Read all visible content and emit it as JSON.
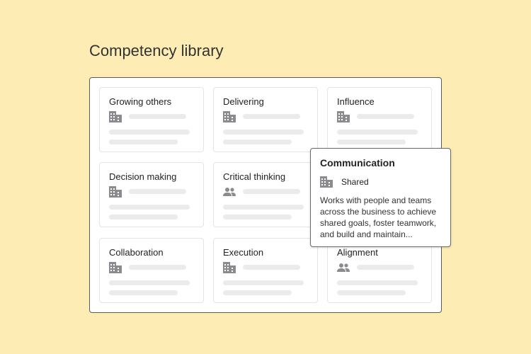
{
  "page": {
    "title": "Competency library"
  },
  "cards": [
    {
      "title": "Growing others",
      "icon": "building-icon"
    },
    {
      "title": "Delivering",
      "icon": "building-icon"
    },
    {
      "title": "Influence",
      "icon": "building-icon"
    },
    {
      "title": "Decision making",
      "icon": "building-icon"
    },
    {
      "title": "Critical thinking",
      "icon": "people-icon"
    },
    {
      "title": "Communication",
      "icon": "building-icon"
    },
    {
      "title": "Collaboration",
      "icon": "building-icon"
    },
    {
      "title": "Execution",
      "icon": "building-icon"
    },
    {
      "title": "Alignment",
      "icon": "people-icon"
    }
  ],
  "popover": {
    "title": "Communication",
    "icon": "building-icon",
    "scope": "Shared",
    "description": "Works with people and teams across the business to achieve shared goals, foster teamwork, and build and maintain..."
  }
}
